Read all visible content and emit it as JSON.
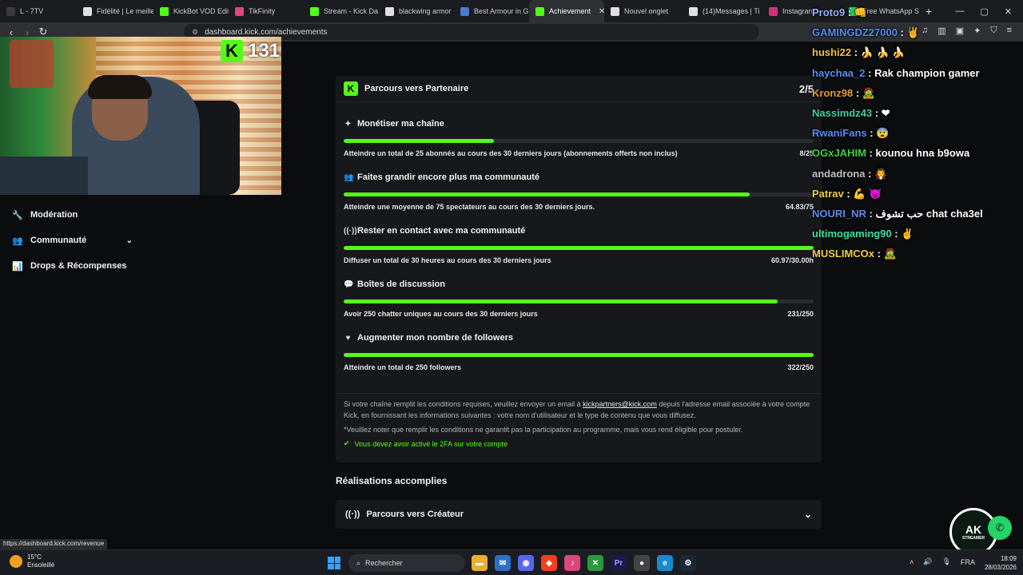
{
  "browser": {
    "tabs": [
      {
        "label": "L - 7TV",
        "color": "#3a3a3a"
      },
      {
        "label": "Fidélité | Le meille",
        "color": "#e0e0e0"
      },
      {
        "label": "KickBot VOD Edit",
        "color": "#53fc18"
      },
      {
        "label": "TikFinity",
        "color": "#e0457b"
      },
      {
        "label": "Stream - Kick Da",
        "color": "#53fc18"
      },
      {
        "label": "blackwing armor",
        "color": "#e0e0e0"
      },
      {
        "label": "Best Armour in G",
        "color": "#4a7bd0"
      },
      {
        "label": "Achievement",
        "color": "#53fc18"
      },
      {
        "label": "Nouvel onglet",
        "color": "#e0e0e0"
      },
      {
        "label": "(14)Messages | Ti",
        "color": "#e0e0e0"
      },
      {
        "label": "Instagram",
        "color": "#d6307a"
      },
      {
        "label": "Free WhatsApp S",
        "color": "#25d366"
      }
    ],
    "url": "dashboard.kick.com/achievements",
    "status_url": "https://dashboard.kick.com/revenue"
  },
  "sidebar": {
    "items": [
      {
        "label": "Modération"
      },
      {
        "label": "Communauté"
      },
      {
        "label": "Drops & Récompenses"
      }
    ]
  },
  "card": {
    "title": "Parcours vers Partenaire",
    "count": "2/5",
    "requirements": [
      {
        "title": "Monétiser ma chaîne",
        "desc": "Atteindre un total de 25 abonnés au cours des 30 derniers jours (abonnements offerts non inclus)",
        "value": "8/25",
        "progress": 0.32
      },
      {
        "title": "Faites grandir encore plus ma communauté",
        "desc": "Atteindre une moyenne de 75 spectateurs au cours des 30 derniers jours.",
        "value": "64.83/75",
        "progress": 0.864
      },
      {
        "title": "Rester en contact avec ma communauté",
        "desc": "Diffuser un total de 30 heures au cours des 30 derniers jours",
        "value": "60.97/30.00h",
        "progress": 1.0
      },
      {
        "title": "Boîtes de discussion",
        "desc": "Avoir 250 chatter uniques au cours des 30 derniers jours",
        "value": "231/250",
        "progress": 0.924
      },
      {
        "title": "Augmenter mon nombre de followers",
        "desc": "Atteindre un total de 250 followers",
        "value": "322/250",
        "progress": 1.0
      }
    ],
    "note_before": "Si votre chaîne remplit les conditions requises, veuillez envoyer un email à ",
    "note_email": "kickpartners@kick.com",
    "note_after": " depuis l'adresse email associée à votre compte Kick, en fournissant les informations suivantes : votre nom d'utilisateur et le type de contenu que vous diffusez.",
    "disclaimer": "*Veuillez noter que remplir les conditions ne garantit pas la participation au programme, mais vous rend éligible pour postuler.",
    "check": "Vous devez avoir activé le 2FA sur votre compte"
  },
  "completed": {
    "title": "Réalisations accomplies",
    "item": "Parcours vers Créateur"
  },
  "webcam": {
    "viewers": "131"
  },
  "chat": [
    {
      "user": "Proto9",
      "color": "#9ab0ff",
      "msg": "👊"
    },
    {
      "user": "GAMINGDZ27000",
      "color": "#5a8df0",
      "msg": "✌"
    },
    {
      "user": "hushi22",
      "color": "#f0c040",
      "msg": "🍌 🍌 🍌"
    },
    {
      "user": "haychaa_2",
      "color": "#5a8df0",
      "msg": "Rak champion gamer"
    },
    {
      "user": "Kronz98",
      "color": "#e0a030",
      "msg": "🧟"
    },
    {
      "user": "Nassimdz43",
      "color": "#40d0a0",
      "msg": "❤"
    },
    {
      "user": "RwaniFans",
      "color": "#5a8df0",
      "msg": "😨"
    },
    {
      "user": "OGxJAHIM",
      "color": "#40d040",
      "msg": "kounou hna b9owa"
    },
    {
      "user": "andadrona",
      "color": "#c0c0c0",
      "msg": "🧛"
    },
    {
      "user": "Patrav",
      "color": "#f0d040",
      "msg": "💪 👿"
    },
    {
      "user": "NOURI_NR",
      "color": "#5a8df0",
      "msg": "حب تشوف chat cha3el"
    },
    {
      "user": "ultimogaming90",
      "color": "#40e0a0",
      "msg": "✌"
    },
    {
      "user": "MUSLIMCOx",
      "color": "#f0d040",
      "msg": "🧟"
    }
  ],
  "brand": {
    "logo_text": "AK",
    "logo_sub": "STREAMER"
  },
  "taskbar": {
    "temp": "15°C",
    "weather": "Ensoleillé",
    "search": "Rechercher",
    "lang": "FRA",
    "time": "18:09",
    "date": "28/03/2026"
  },
  "colors": {
    "accent": "#53fc18",
    "card": "#17181b",
    "background": "#0b0c0e"
  }
}
